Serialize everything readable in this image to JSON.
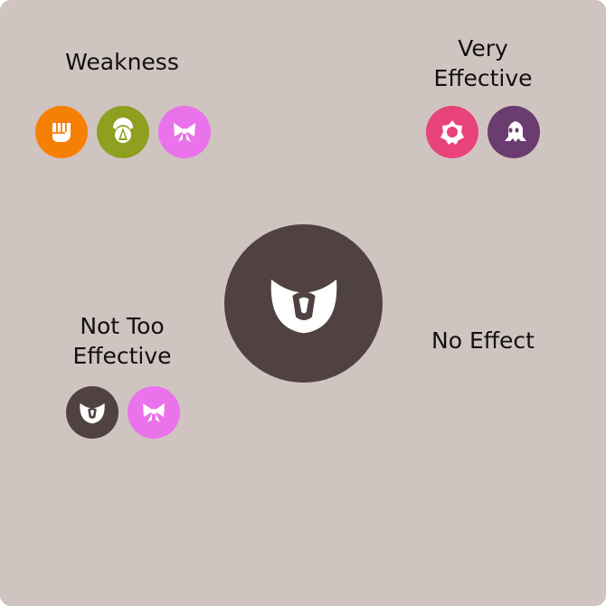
{
  "labels": {
    "weakness": "Weakness",
    "very_effective_1": "Very",
    "very_effective_2": "Effective",
    "not_too_effective_1": "Not Too",
    "not_too_effective_2": "Effective",
    "no_effect": "No Effect"
  },
  "main_type": {
    "icon": "dark-type-icon",
    "color": "#4f4240"
  },
  "weakness_icons": [
    {
      "icon": "fighting-fist-icon",
      "color": "#f68005"
    },
    {
      "icon": "bug-icon",
      "color": "#8fa020"
    },
    {
      "icon": "fairy-bow-icon",
      "color": "#ea72ea"
    }
  ],
  "very_effective_icons": [
    {
      "icon": "psychic-icon",
      "color": "#e8437a"
    },
    {
      "icon": "ghost-icon",
      "color": "#6b3c6f"
    }
  ],
  "not_too_effective_icons": [
    {
      "icon": "dark-type-icon",
      "color": "#4f4240"
    },
    {
      "icon": "fairy-bow-icon",
      "color": "#ea72ea"
    }
  ]
}
